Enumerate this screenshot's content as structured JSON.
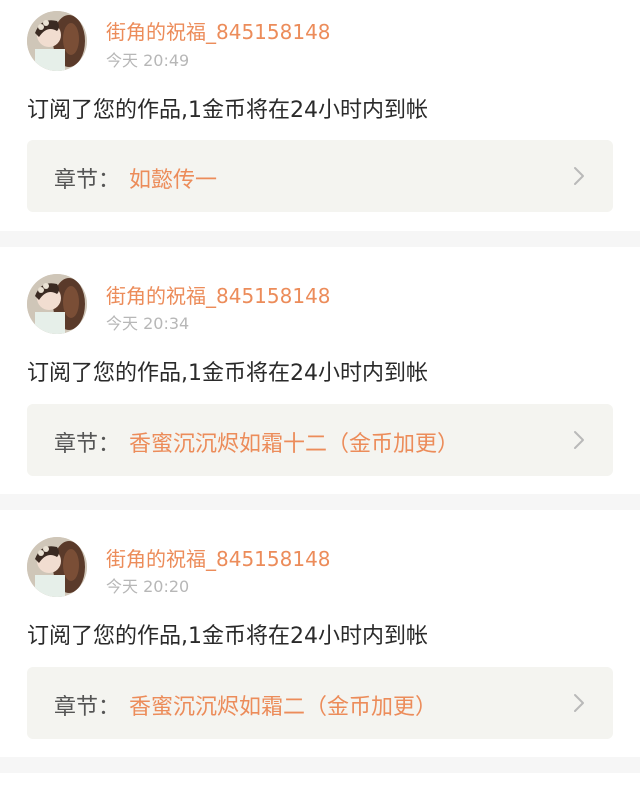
{
  "notifications": [
    {
      "username": "街角的祝福_845158148",
      "timestamp": "今天 20:49",
      "message": "订阅了您的作品,1金币将在24小时内到帐",
      "chapter_prefix": "章节：",
      "chapter_title": "如懿传一"
    },
    {
      "username": "街角的祝福_845158148",
      "timestamp": "今天 20:34",
      "message": "订阅了您的作品,1金币将在24小时内到帐",
      "chapter_prefix": "章节：",
      "chapter_title": "香蜜沉沉烬如霜十二（金币加更）"
    },
    {
      "username": "街角的祝福_845158148",
      "timestamp": "今天 20:20",
      "message": "订阅了您的作品,1金币将在24小时内到帐",
      "chapter_prefix": "章节：",
      "chapter_title": "香蜜沉沉烬如霜二（金币加更）"
    }
  ],
  "colors": {
    "accent": "#ec8c5a",
    "text": "#2a2a2a",
    "muted": "#b7b7b7",
    "chapter_bg": "#f4f4f0",
    "separator": "#f6f6f6"
  },
  "icons": {
    "avatar": "avatar-image",
    "chevron": "chevron-right-icon"
  }
}
